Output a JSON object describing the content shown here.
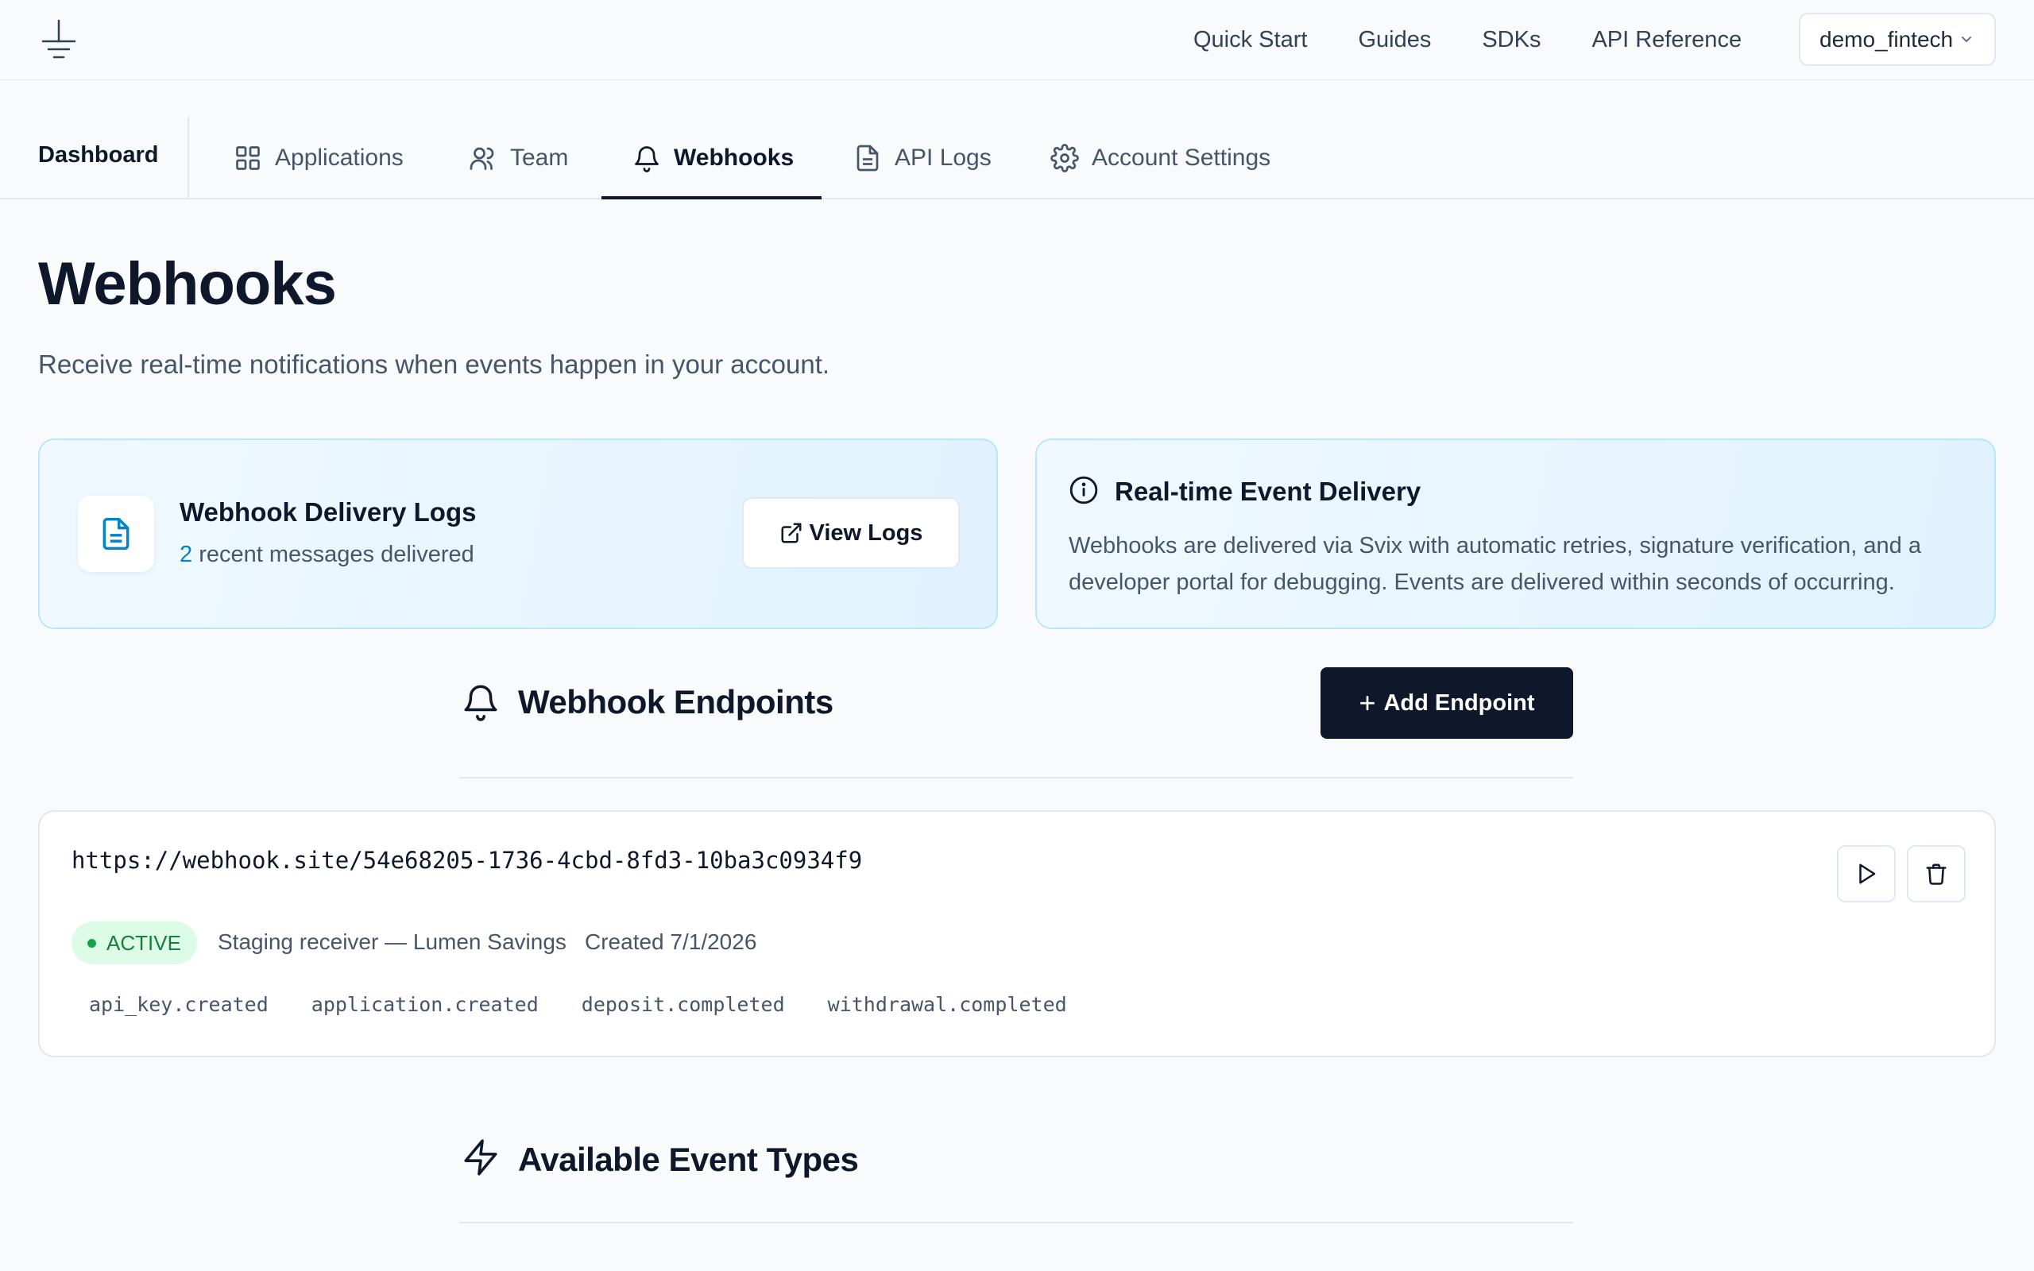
{
  "topnav": {
    "links": [
      "Quick Start",
      "Guides",
      "SDKs",
      "API Reference"
    ],
    "account": "demo_fintech"
  },
  "tabs": {
    "brand": "Dashboard",
    "items": [
      {
        "label": "Applications",
        "icon": "grid-icon"
      },
      {
        "label": "Team",
        "icon": "users-icon"
      },
      {
        "label": "Webhooks",
        "icon": "bell-icon",
        "active": true
      },
      {
        "label": "API Logs",
        "icon": "file-text-icon"
      },
      {
        "label": "Account Settings",
        "icon": "gear-icon"
      }
    ]
  },
  "page": {
    "title": "Webhooks",
    "subtitle": "Receive real-time notifications when events happen in your account."
  },
  "delivery_logs": {
    "title": "Webhook Delivery Logs",
    "count": "2",
    "count_suffix": " recent messages delivered",
    "button": "View Logs"
  },
  "realtime": {
    "title": "Real-time Event Delivery",
    "body": "Webhooks are delivered via Svix with automatic retries, signature verification, and a developer portal for debugging. Events are delivered within seconds of occurring."
  },
  "endpoints": {
    "title": "Webhook Endpoints",
    "add_button": "Add Endpoint",
    "items": [
      {
        "url": "https://webhook.site/54e68205-1736-4cbd-8fd3-10ba3c0934f9",
        "status": "ACTIVE",
        "description": "Staging receiver — Lumen Savings",
        "created": "Created 7/1/2026",
        "events": [
          "api_key.created",
          "application.created",
          "deposit.completed",
          "withdrawal.completed"
        ]
      }
    ]
  },
  "event_types": {
    "title": "Available Event Types"
  },
  "colors": {
    "primary": "#0f172a",
    "accent": "#0284c7",
    "success": "#16a34a",
    "card_border": "#bae6fd"
  }
}
